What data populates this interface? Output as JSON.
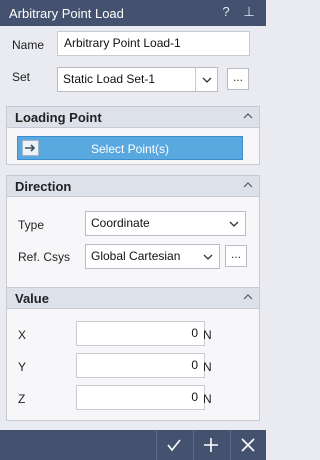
{
  "window": {
    "title": "Arbitrary Point Load",
    "help_glyph": "?",
    "pin_glyph": "⊥"
  },
  "form": {
    "name_label": "Name",
    "name_value": "Arbitrary Point Load-1",
    "set_label": "Set",
    "set_value": "Static Load Set-1",
    "more_label": "..."
  },
  "loading_point": {
    "title": "Loading Point",
    "select_label": "Select Point(s)"
  },
  "direction": {
    "title": "Direction",
    "type_label": "Type",
    "type_value": "Coordinate",
    "csys_label": "Ref. Csys",
    "csys_value": "Global Cartesian",
    "more_label": "..."
  },
  "value": {
    "title": "Value",
    "rows": [
      {
        "label": "X",
        "value": "0",
        "unit": "N"
      },
      {
        "label": "Y",
        "value": "0",
        "unit": "N"
      },
      {
        "label": "Z",
        "value": "0",
        "unit": "N"
      }
    ]
  },
  "footer": {
    "icons": [
      "check-icon",
      "plus-icon",
      "close-icon"
    ]
  },
  "colors": {
    "titlebar": "#44516f",
    "accent_button": "#5aa8e0",
    "section_header": "#dde1ea",
    "background": "#e9ebf0"
  }
}
